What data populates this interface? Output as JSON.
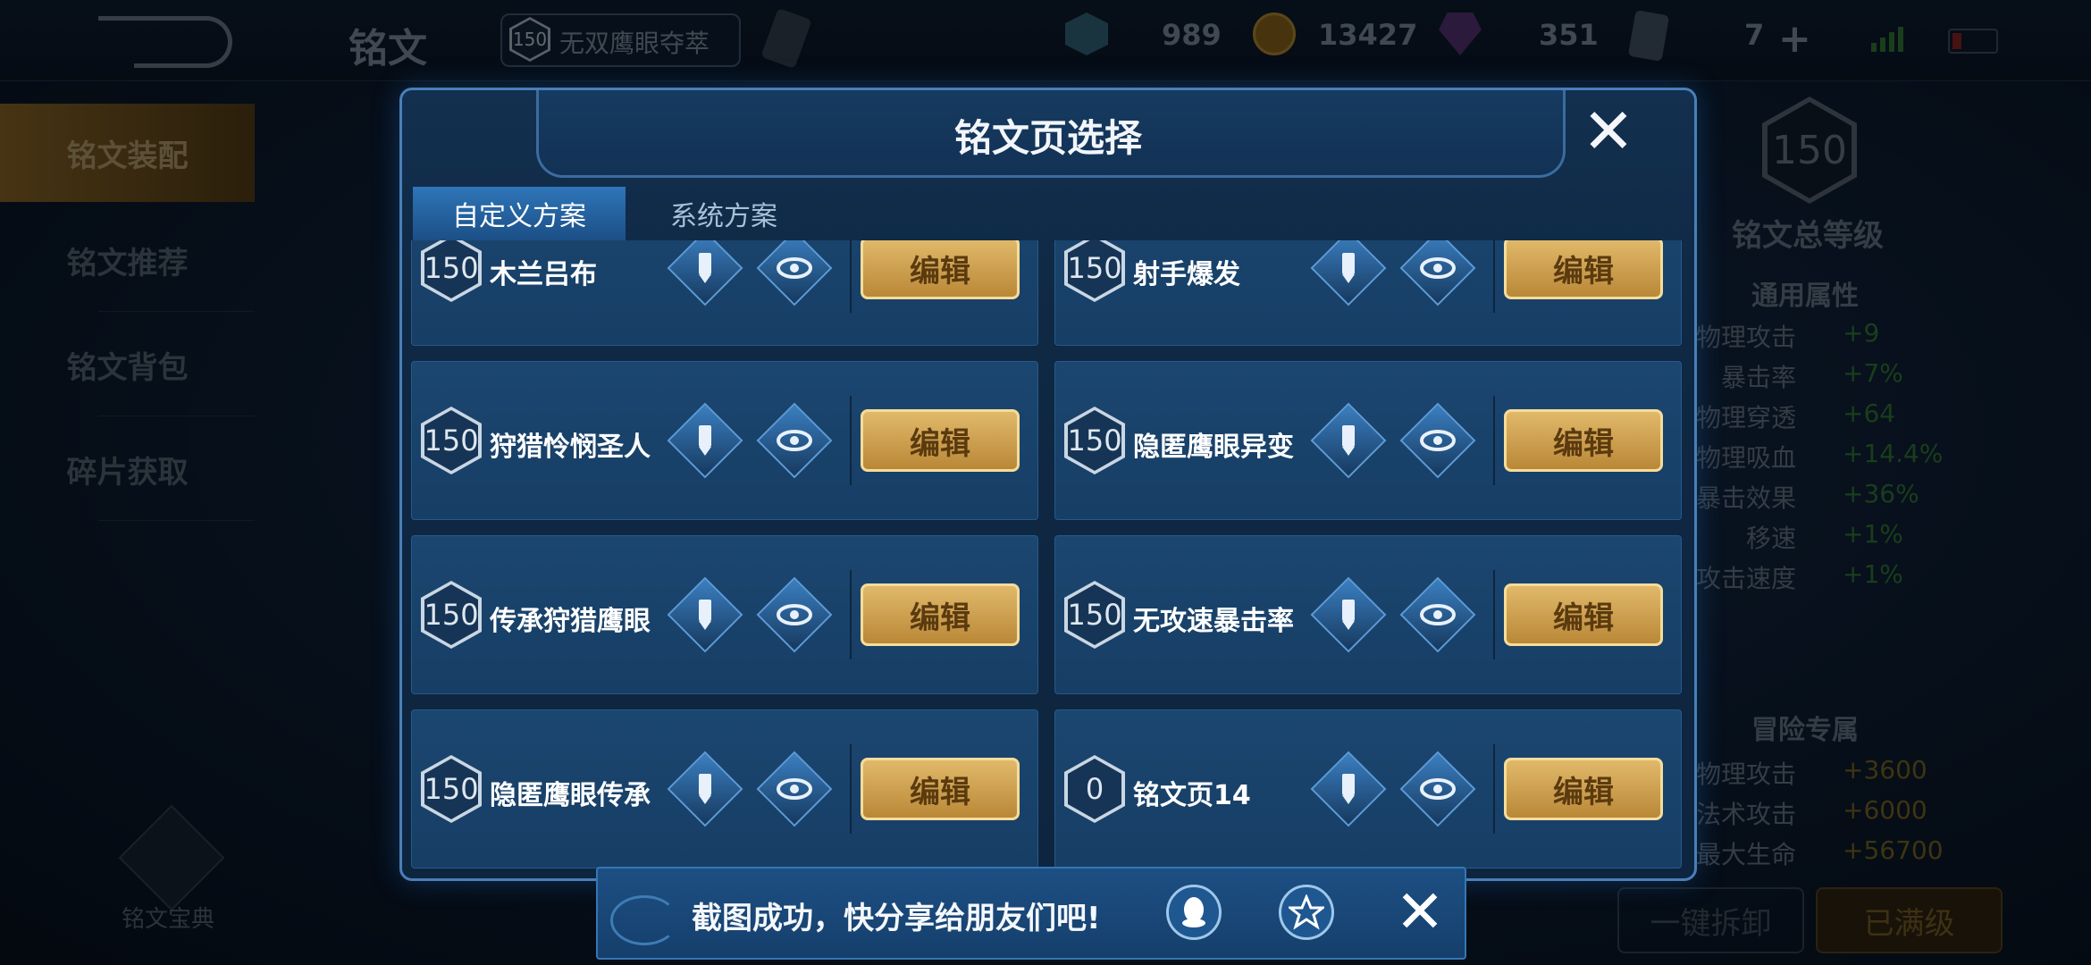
{
  "header": {
    "title": "铭文",
    "current_page_level": "150",
    "current_page_name": "无双鹰眼夺萃",
    "resources": [
      {
        "icon": "crystal-icon",
        "value": "989"
      },
      {
        "icon": "gold-coin-icon",
        "value": "13427"
      },
      {
        "icon": "gem-icon",
        "value": "351"
      },
      {
        "icon": "card-icon",
        "value": "7"
      }
    ]
  },
  "sidebar": {
    "items": [
      {
        "label": "铭文装配",
        "active": true
      },
      {
        "label": "铭文推荐",
        "active": false
      },
      {
        "label": "铭文背包",
        "active": false
      },
      {
        "label": "碎片获取",
        "active": false
      }
    ],
    "codex_label": "铭文宝典"
  },
  "right_panel": {
    "total_level": "150",
    "total_level_label": "铭文总等级",
    "general_heading": "通用属性",
    "general_stats": [
      {
        "name": "物理攻击",
        "value": "+9"
      },
      {
        "name": "暴击率",
        "value": "+7%"
      },
      {
        "name": "物理穿透",
        "value": "+64"
      },
      {
        "name": "物理吸血",
        "value": "+14.4%"
      },
      {
        "name": "暴击效果",
        "value": "+36%"
      },
      {
        "name": "移速",
        "value": "+1%"
      },
      {
        "name": "攻击速度",
        "value": "+1%"
      }
    ],
    "adventure_heading": "冒险专属",
    "adventure_stats": [
      {
        "name": "物理攻击",
        "value": "+3600"
      },
      {
        "name": "法术攻击",
        "value": "+6000"
      },
      {
        "name": "最大生命",
        "value": "+56700"
      }
    ],
    "unequip_label": "一键拆卸",
    "full_label": "已满级"
  },
  "modal": {
    "title": "铭文页选择",
    "tabs": [
      {
        "label": "自定义方案",
        "active": true
      },
      {
        "label": "系统方案",
        "active": false
      }
    ],
    "edit_label": "编辑",
    "pages": [
      {
        "level": "150",
        "name": "木兰吕布"
      },
      {
        "level": "150",
        "name": "射手爆发"
      },
      {
        "level": "150",
        "name": "狩猎怜悯圣人"
      },
      {
        "level": "150",
        "name": "隐匿鹰眼异变"
      },
      {
        "level": "150",
        "name": "传承狩猎鹰眼"
      },
      {
        "level": "150",
        "name": "无攻速暴击率"
      },
      {
        "level": "150",
        "name": "隐匿鹰眼传承"
      },
      {
        "level": "0",
        "name": "铭文页14"
      }
    ]
  },
  "toast": {
    "message": "截图成功，快分享给朋友们吧!"
  },
  "colors": {
    "accent": "#2e75b8",
    "edit_button": "#d2a652",
    "stat_value": "#2c6b2f"
  }
}
